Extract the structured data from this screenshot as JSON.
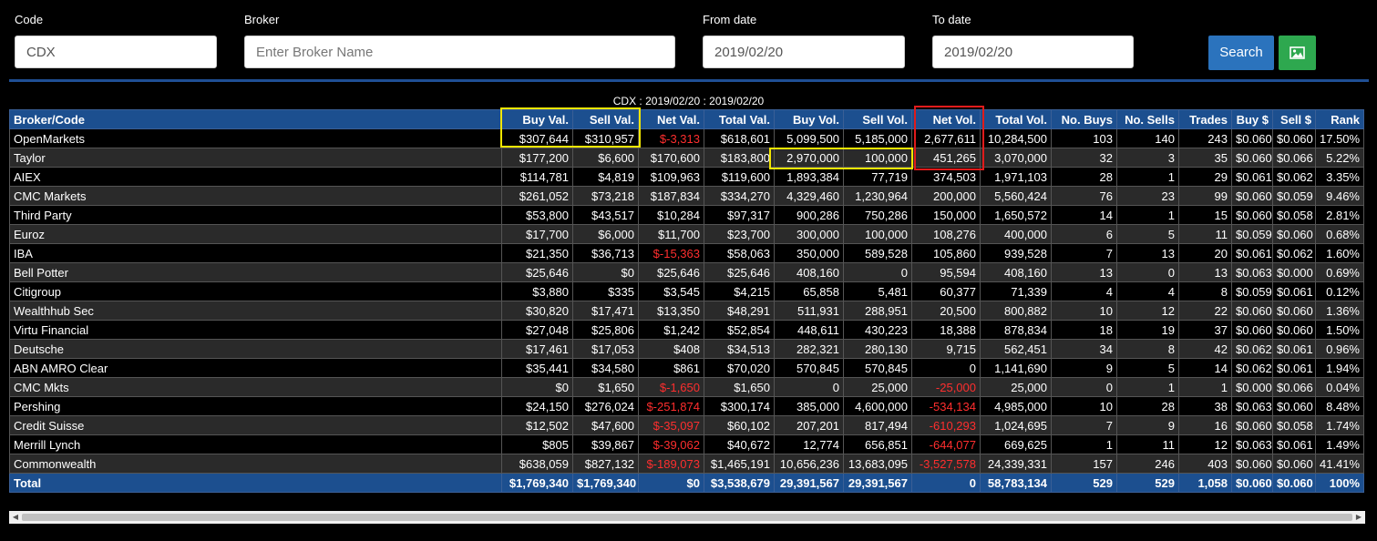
{
  "filters": {
    "code_label": "Code",
    "code_value": "CDX",
    "broker_label": "Broker",
    "broker_placeholder": "Enter Broker Name",
    "from_label": "From date",
    "from_value": "2019/02/20",
    "to_label": "To date",
    "to_value": "2019/02/20",
    "search_label": "Search",
    "image_button_icon": "image-icon"
  },
  "caption": "CDX : 2019/02/20 : 2019/02/20",
  "columns": [
    "Broker/Code",
    "Buy Val.",
    "Sell Val.",
    "Net Val.",
    "Total Val.",
    "Buy Vol.",
    "Sell Vol.",
    "Net Vol.",
    "Total Vol.",
    "No. Buys",
    "No. Sells",
    "Trades",
    "Buy $",
    "Sell $",
    "Rank"
  ],
  "rows": [
    [
      "OpenMarkets",
      "$307,644",
      "$310,957",
      "$-3,313",
      "$618,601",
      "5,099,500",
      "5,185,000",
      "2,677,611",
      "10,284,500",
      "103",
      "140",
      "243",
      "$0.060",
      "$0.060",
      "17.50%"
    ],
    [
      "Taylor",
      "$177,200",
      "$6,600",
      "$170,600",
      "$183,800",
      "2,970,000",
      "100,000",
      "451,265",
      "3,070,000",
      "32",
      "3",
      "35",
      "$0.060",
      "$0.066",
      "5.22%"
    ],
    [
      "AIEX",
      "$114,781",
      "$4,819",
      "$109,963",
      "$119,600",
      "1,893,384",
      "77,719",
      "374,503",
      "1,971,103",
      "28",
      "1",
      "29",
      "$0.061",
      "$0.062",
      "3.35%"
    ],
    [
      "CMC Markets",
      "$261,052",
      "$73,218",
      "$187,834",
      "$334,270",
      "4,329,460",
      "1,230,964",
      "200,000",
      "5,560,424",
      "76",
      "23",
      "99",
      "$0.060",
      "$0.059",
      "9.46%"
    ],
    [
      "Third Party",
      "$53,800",
      "$43,517",
      "$10,284",
      "$97,317",
      "900,286",
      "750,286",
      "150,000",
      "1,650,572",
      "14",
      "1",
      "15",
      "$0.060",
      "$0.058",
      "2.81%"
    ],
    [
      "Euroz",
      "$17,700",
      "$6,000",
      "$11,700",
      "$23,700",
      "300,000",
      "100,000",
      "108,276",
      "400,000",
      "6",
      "5",
      "11",
      "$0.059",
      "$0.060",
      "0.68%"
    ],
    [
      "IBA",
      "$21,350",
      "$36,713",
      "$-15,363",
      "$58,063",
      "350,000",
      "589,528",
      "105,860",
      "939,528",
      "7",
      "13",
      "20",
      "$0.061",
      "$0.062",
      "1.60%"
    ],
    [
      "Bell Potter",
      "$25,646",
      "$0",
      "$25,646",
      "$25,646",
      "408,160",
      "0",
      "95,594",
      "408,160",
      "13",
      "0",
      "13",
      "$0.063",
      "$0.000",
      "0.69%"
    ],
    [
      "Citigroup",
      "$3,880",
      "$335",
      "$3,545",
      "$4,215",
      "65,858",
      "5,481",
      "60,377",
      "71,339",
      "4",
      "4",
      "8",
      "$0.059",
      "$0.061",
      "0.12%"
    ],
    [
      "Wealthhub Sec",
      "$30,820",
      "$17,471",
      "$13,350",
      "$48,291",
      "511,931",
      "288,951",
      "20,500",
      "800,882",
      "10",
      "12",
      "22",
      "$0.060",
      "$0.060",
      "1.36%"
    ],
    [
      "Virtu Financial",
      "$27,048",
      "$25,806",
      "$1,242",
      "$52,854",
      "448,611",
      "430,223",
      "18,388",
      "878,834",
      "18",
      "19",
      "37",
      "$0.060",
      "$0.060",
      "1.50%"
    ],
    [
      "Deutsche",
      "$17,461",
      "$17,053",
      "$408",
      "$34,513",
      "282,321",
      "280,130",
      "9,715",
      "562,451",
      "34",
      "8",
      "42",
      "$0.062",
      "$0.061",
      "0.96%"
    ],
    [
      "ABN AMRO Clear",
      "$35,441",
      "$34,580",
      "$861",
      "$70,020",
      "570,845",
      "570,845",
      "0",
      "1,141,690",
      "9",
      "5",
      "14",
      "$0.062",
      "$0.061",
      "1.94%"
    ],
    [
      "CMC Mkts",
      "$0",
      "$1,650",
      "$-1,650",
      "$1,650",
      "0",
      "25,000",
      "-25,000",
      "25,000",
      "0",
      "1",
      "1",
      "$0.000",
      "$0.066",
      "0.04%"
    ],
    [
      "Pershing",
      "$24,150",
      "$276,024",
      "$-251,874",
      "$300,174",
      "385,000",
      "4,600,000",
      "-534,134",
      "4,985,000",
      "10",
      "28",
      "38",
      "$0.063",
      "$0.060",
      "8.48%"
    ],
    [
      "Credit Suisse",
      "$12,502",
      "$47,600",
      "$-35,097",
      "$60,102",
      "207,201",
      "817,494",
      "-610,293",
      "1,024,695",
      "7",
      "9",
      "16",
      "$0.060",
      "$0.058",
      "1.74%"
    ],
    [
      "Merrill Lynch",
      "$805",
      "$39,867",
      "$-39,062",
      "$40,672",
      "12,774",
      "656,851",
      "-644,077",
      "669,625",
      "1",
      "11",
      "12",
      "$0.063",
      "$0.061",
      "1.49%"
    ],
    [
      "Commonwealth",
      "$638,059",
      "$827,132",
      "$-189,073",
      "$1,465,191",
      "10,656,236",
      "13,683,095",
      "-3,527,578",
      "24,339,331",
      "157",
      "246",
      "403",
      "$0.060",
      "$0.060",
      "41.41%"
    ]
  ],
  "total": [
    "Total",
    "$1,769,340",
    "$1,769,340",
    "$0",
    "$3,538,679",
    "29,391,567",
    "29,391,567",
    "0",
    "58,783,134",
    "529",
    "529",
    "1,058",
    "$0.060",
    "$0.060",
    "100%"
  ],
  "colors": {
    "negative": "#ff2e2e",
    "header": "#1c4f8f",
    "highlight_yellow": "#f2e600",
    "highlight_red": "#e01b1b"
  }
}
